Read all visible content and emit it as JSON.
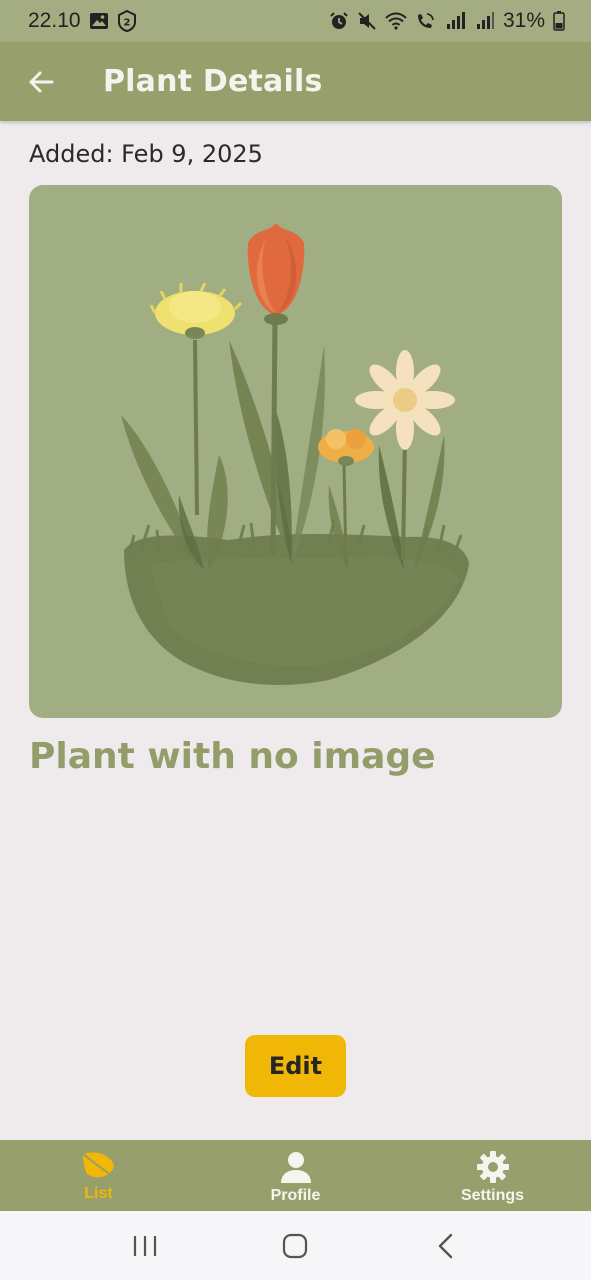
{
  "status_bar": {
    "time": "22.10",
    "battery": "31%"
  },
  "app_bar": {
    "title": "Plant Details",
    "back_icon": "arrow-left-icon"
  },
  "plant": {
    "added": "Added: Feb 9, 2025",
    "name": "Plant with no image",
    "image_icon": "watercolor-flowers-illustration"
  },
  "actions": {
    "edit_label": "Edit"
  },
  "bottom_nav": {
    "items": [
      {
        "label": "List",
        "icon": "leaf-icon",
        "active": true
      },
      {
        "label": "Profile",
        "icon": "person-icon",
        "active": false
      },
      {
        "label": "Settings",
        "icon": "gear-icon",
        "active": false
      }
    ]
  },
  "system_nav": {
    "icons": [
      "recent-apps-icon",
      "home-icon",
      "back-icon"
    ]
  },
  "colors": {
    "primary": "#97a06c",
    "status_bar": "#a4ad82",
    "accent": "#f1b707",
    "background": "#efebec",
    "image_background": "#a1ad82",
    "plant_name": "#939d6a"
  }
}
